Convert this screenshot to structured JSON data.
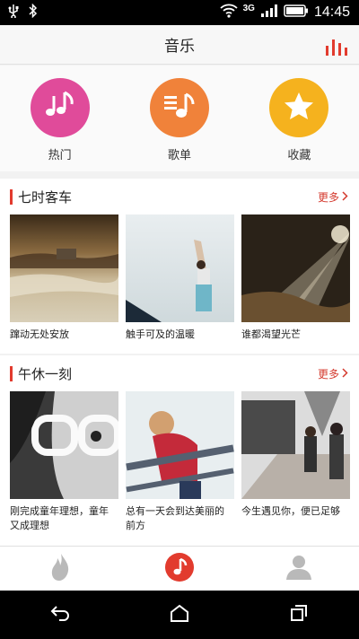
{
  "status_bar": {
    "network_label": "3G",
    "time": "14:45",
    "icons": [
      "usb-icon",
      "bluetooth-icon",
      "wifi-icon",
      "signal-icon",
      "battery-icon"
    ]
  },
  "header": {
    "title": "音乐",
    "right_icon": "equalizer-icon"
  },
  "categories": [
    {
      "label": "热门",
      "icon": "music-notes-icon",
      "color": "#e04b9a"
    },
    {
      "label": "歌单",
      "icon": "playlist-icon",
      "color": "#f0823a"
    },
    {
      "label": "收藏",
      "icon": "star-icon",
      "color": "#f5b21e"
    }
  ],
  "sections": [
    {
      "title": "七时客车",
      "more": "更多",
      "items": [
        {
          "caption": "蹿动无处安放",
          "image": "stormy-sea-photo"
        },
        {
          "caption": "触手可及的温暖",
          "image": "reaching-woman-photo"
        },
        {
          "caption": "谁都渴望光芒",
          "image": "light-rays-cave-photo"
        }
      ]
    },
    {
      "title": "午休一刻",
      "more": "更多",
      "items": [
        {
          "caption": "刚完成童年理想，童年又成理想",
          "image": "girl-glasses-photo"
        },
        {
          "caption": "总有一天会到达美丽的前方",
          "image": "girl-railing-photo"
        },
        {
          "caption": "今生遇见你，便已足够",
          "image": "couple-walking-photo"
        }
      ]
    }
  ],
  "tabbar": [
    {
      "icon": "flame-icon",
      "active": false
    },
    {
      "icon": "music-note-icon",
      "active": true
    },
    {
      "icon": "user-icon",
      "active": false
    }
  ],
  "navbar": [
    "back-icon",
    "home-icon",
    "recent-apps-icon"
  ],
  "colors": {
    "accent": "#e23b2e",
    "status_bar": "#000000",
    "nav_bar": "#000000"
  }
}
